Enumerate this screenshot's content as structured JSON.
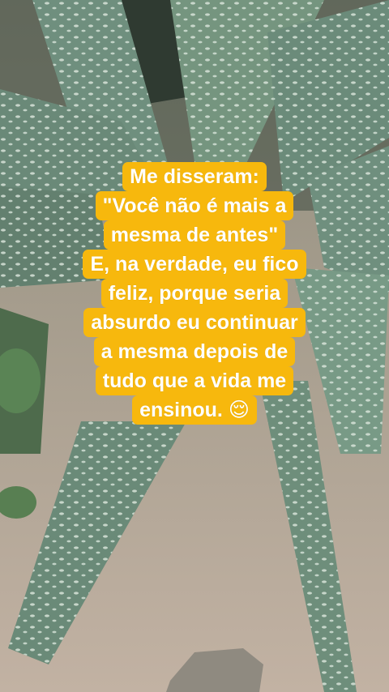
{
  "caption_lines": [
    "Me disseram:",
    "\"Você não é mais a",
    "mesma de antes\"",
    "E, na verdade, eu fico",
    "feliz, porque seria",
    "absurdo eu continuar",
    "a mesma depois de",
    "tudo que a vida me",
    "ensinou. 😌"
  ],
  "colors": {
    "caption_background": "#f7b80d",
    "caption_text": "#ffffff",
    "leaf": "#6f8f7e",
    "soil": "#b7a99a"
  }
}
